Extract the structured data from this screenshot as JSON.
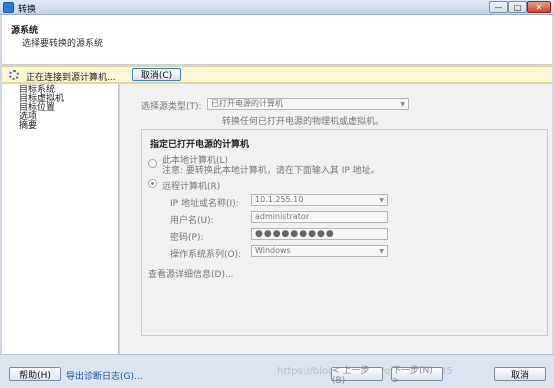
{
  "window": {
    "title": "转换"
  },
  "header": {
    "title": "源系统",
    "subtitle": "选择要转换的源系统"
  },
  "connection": {
    "status": "正在连接到源计算机...",
    "cancel_label": "取消(C)"
  },
  "nav": {
    "items": [
      "目标系统",
      "目标虚拟机",
      "目标位置",
      "选项",
      "摘要"
    ]
  },
  "source": {
    "type_label": "选择源类型(T):",
    "type_value": "已打开电源的计算机",
    "type_hint": "转换任何已打开电源的物理机或虚拟机。",
    "group_title": "指定已打开电源的计算机",
    "local_label": "此本地计算机(L)",
    "local_note": "注意: 要转换此本地计算机，请在下面输入其 IP 地址。",
    "remote_label": "远程计算机(R)",
    "ip_label": "IP 地址或名称(I):",
    "ip_value": "10.1.255.10",
    "user_label": "用户名(U):",
    "user_value": "administrator",
    "password_label": "密码(P):",
    "password_value": "●●●●●●●●●",
    "os_label": "操作系统系列(O):",
    "os_value": "Windows",
    "details_link": "查看源详细信息(D)..."
  },
  "footer": {
    "help_label": "帮助(H)",
    "export_label": "导出诊断日志(G)...",
    "back_label": "< 上一步(B)",
    "next_label": "下一步(N) >",
    "cancel_label": "取消",
    "watermark": "https://blog.csdn.net/qq_41489545"
  }
}
